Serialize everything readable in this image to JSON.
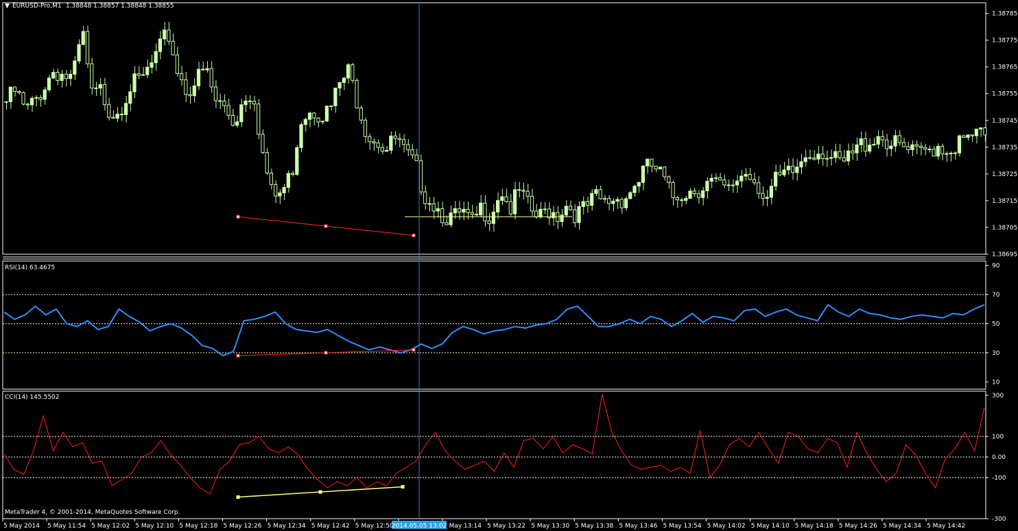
{
  "window": {
    "symbol_label": "EURUSD-Pro,M1",
    "ohlc_text": "1.38848 1.38857 1.38848 1.38855",
    "copyright": "MetaTrader 4, © 2001-2014, MetaQuotes Software Corp."
  },
  "colors": {
    "background": "#000000",
    "candle": "#ccffaa",
    "grid": "#ffffff",
    "rsi": "#2f8fff",
    "cci": "#ff2020",
    "crosshair": "#3a7ad0",
    "trendline_red": "#ff3030",
    "trendline_yellow": "#ffff80",
    "level_dashed": "#ffffff"
  },
  "chart_data": [
    {
      "type": "candlestick",
      "title": "EURUSD-Pro,M1",
      "ylim": [
        1.38695,
        1.38789
      ],
      "y_ticks": [
        "1.38785",
        "1.38775",
        "1.38765",
        "1.38755",
        "1.38745",
        "1.38735",
        "1.38725",
        "1.38715",
        "1.38705",
        "1.38695"
      ],
      "x_ticks": [
        "5 May 2014",
        "5 May 11:54",
        "5 May 12:02",
        "5 May 12:10",
        "5 May 12:18",
        "5 May 12:26",
        "5 May 12:34",
        "5 May 12:42",
        "5 May 12:50",
        "5 May 13:06",
        "5 May 13:14",
        "5 May 13:22",
        "5 May 13:30",
        "5 May 13:38",
        "5 May 13:46",
        "5 May 13:54",
        "5 May 14:02",
        "5 May 14:10",
        "5 May 14:18",
        "5 May 14:26",
        "5 May 14:34",
        "5 May 14:42"
      ],
      "crosshair_label": "2014.05.05 13:02",
      "close_path": [
        1.38752,
        1.38756,
        1.38748,
        1.38752,
        1.38758,
        1.38764,
        1.38762,
        1.3876,
        1.38778,
        1.38754,
        1.38756,
        1.38748,
        1.3875,
        1.38758,
        1.38759,
        1.38764,
        1.3877,
        1.38778,
        1.38764,
        1.38756,
        1.3876,
        1.38764,
        1.38752,
        1.3875,
        1.38744,
        1.38754,
        1.38756,
        1.38732,
        1.38716,
        1.38718,
        1.38725,
        1.38746,
        1.3875,
        1.38748,
        1.38748,
        1.38758,
        1.38763,
        1.38752,
        1.3874,
        1.38738,
        1.38734,
        1.38738,
        1.38732,
        1.38728,
        1.38718,
        1.38714,
        1.3871,
        1.38708,
        1.3871,
        1.38706,
        1.38712,
        1.3871,
        1.3872,
        1.38712,
        1.38718,
        1.38712,
        1.38708,
        1.38712,
        1.3871,
        1.38714,
        1.3871,
        1.38712,
        1.38716,
        1.38714,
        1.38716,
        1.38716,
        1.3872,
        1.38726,
        1.38728,
        1.38724,
        1.38716,
        1.38718,
        1.38719,
        1.3872,
        1.38722,
        1.3872,
        1.38718,
        1.38724,
        1.38726,
        1.38722,
        1.38716,
        1.38722,
        1.38724,
        1.38726,
        1.38732,
        1.38734,
        1.38734,
        1.3873,
        1.38728,
        1.38732,
        1.38736,
        1.38738,
        1.3874,
        1.38736,
        1.38735,
        1.38733,
        1.38732,
        1.38734,
        1.38736,
        1.38734,
        1.38736,
        1.38737,
        1.3874,
        1.38738
      ],
      "annotations": {
        "red_trendline": {
          "start_price": 1.38709,
          "end_price": 1.38702
        },
        "yellow_trendline": {
          "price": 1.38709
        }
      }
    },
    {
      "type": "line",
      "title": "RSI(14) 63.4675",
      "series": [
        {
          "name": "RSI(14)",
          "values": [
            58,
            53,
            56,
            62,
            56,
            60,
            50,
            48,
            52,
            46,
            48,
            60,
            55,
            51,
            45,
            48,
            50,
            47,
            42,
            35,
            33,
            28,
            31,
            52,
            53,
            55,
            58,
            50,
            46,
            45,
            44,
            46,
            42,
            38,
            35,
            32,
            34,
            32,
            30,
            32,
            36,
            33,
            36,
            44,
            48,
            46,
            43,
            45,
            46,
            48,
            47,
            49,
            50,
            53,
            60,
            62,
            55,
            48,
            48,
            50,
            53,
            50,
            55,
            53,
            48,
            52,
            57,
            51,
            55,
            54,
            52,
            59,
            60,
            55,
            58,
            60,
            56,
            54,
            52,
            63,
            58,
            55,
            60,
            57,
            56,
            54,
            53,
            55,
            56,
            55,
            54,
            57,
            56,
            60,
            63
          ]
        }
      ],
      "ylim": [
        5,
        93
      ],
      "y_ticks": [
        "90",
        "70",
        "50",
        "30",
        "10"
      ],
      "levels": [
        70,
        50,
        30
      ],
      "trendline": {
        "start": 28,
        "end": 32
      }
    },
    {
      "type": "line",
      "title": "CCI(14) 145.5502",
      "series": [
        {
          "name": "CCI(14)",
          "values": [
            15,
            -60,
            -85,
            30,
            200,
            30,
            120,
            50,
            70,
            -30,
            -20,
            -140,
            -110,
            -80,
            0,
            20,
            80,
            10,
            -40,
            -100,
            -150,
            -180,
            -60,
            -20,
            60,
            70,
            100,
            40,
            20,
            50,
            10,
            -60,
            -110,
            -150,
            -120,
            -140,
            -100,
            -150,
            -120,
            -140,
            -80,
            -50,
            -20,
            60,
            120,
            30,
            -20,
            -60,
            -40,
            -20,
            -70,
            20,
            -50,
            80,
            90,
            40,
            100,
            20,
            60,
            40,
            15,
            305,
            120,
            30,
            -40,
            -60,
            -50,
            -40,
            -70,
            -50,
            -80,
            130,
            -100,
            -40,
            60,
            90,
            50,
            120,
            40,
            -30,
            120,
            100,
            40,
            20,
            90,
            70,
            -50,
            120,
            20,
            -60,
            -120,
            -80,
            60,
            10,
            -80,
            -150,
            -10,
            40,
            120,
            30,
            240
          ]
        }
      ],
      "ylim": [
        -300,
        320
      ],
      "y_ticks": [
        "300",
        "100",
        "0.00",
        "-100",
        "-300"
      ],
      "levels": [
        100,
        0,
        -100
      ],
      "trendline": {
        "start": -195,
        "end": -145
      }
    }
  ]
}
